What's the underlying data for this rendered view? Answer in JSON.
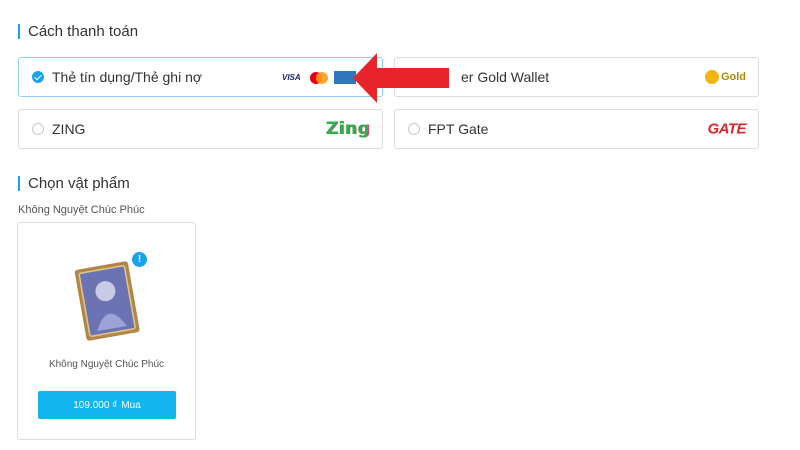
{
  "payment": {
    "title": "Cách thanh toán",
    "options": [
      {
        "label": "Thẻ tín dụng/Thẻ ghi nợ",
        "selected": true,
        "logos": [
          "visa-icon",
          "mastercard-icon",
          "amex-icon"
        ],
        "visa_text": "VISA"
      },
      {
        "label": "er Gold Wallet",
        "selected": false,
        "logo": "gold-wallet-logo",
        "logo_text": "Gold"
      },
      {
        "label": "ZING",
        "selected": false,
        "logo": "zing-logo",
        "logo_text": "Zing"
      },
      {
        "label": "FPT Gate",
        "selected": false,
        "logo": "fpt-gate-logo",
        "logo_text": "GATE"
      }
    ]
  },
  "items": {
    "title": "Chọn vật phẩm",
    "subtitle": "Không Nguyệt Chúc Phúc",
    "cards": [
      {
        "name": "Không Nguyệt Chúc Phúc",
        "price": "109.000 ₫",
        "buy_label": "Mua",
        "info_badge": "!"
      }
    ]
  },
  "colors": {
    "accent": "#1aa3e8",
    "button": "#12b6ef",
    "arrow": "#e8232a"
  }
}
